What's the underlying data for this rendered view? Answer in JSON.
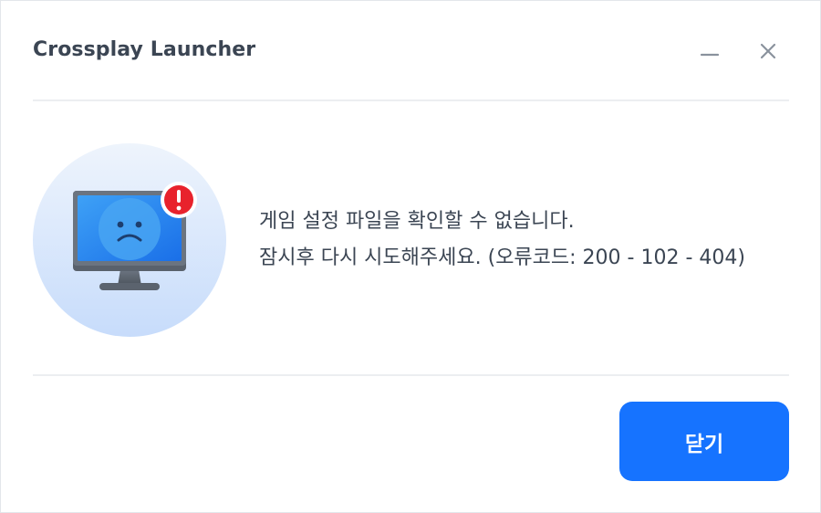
{
  "window": {
    "title": "Crossplay Launcher",
    "minimize_icon": "minimize-icon",
    "close_icon": "close-icon"
  },
  "illustration": {
    "icon": "sad-monitor-icon",
    "badge_icon": "alert-badge-icon",
    "badge_text": "!"
  },
  "message": {
    "line1": "게임 설정 파일을 확인할 수 없습니다.",
    "line2": "잠시후 다시 시도해주세요. (오류코드: 200 - 102 - 404)"
  },
  "footer": {
    "close_label": "닫기"
  },
  "colors": {
    "accent": "#1673ff",
    "text": "#3b4553",
    "alert": "#e8222c",
    "divider": "#eceef1"
  }
}
